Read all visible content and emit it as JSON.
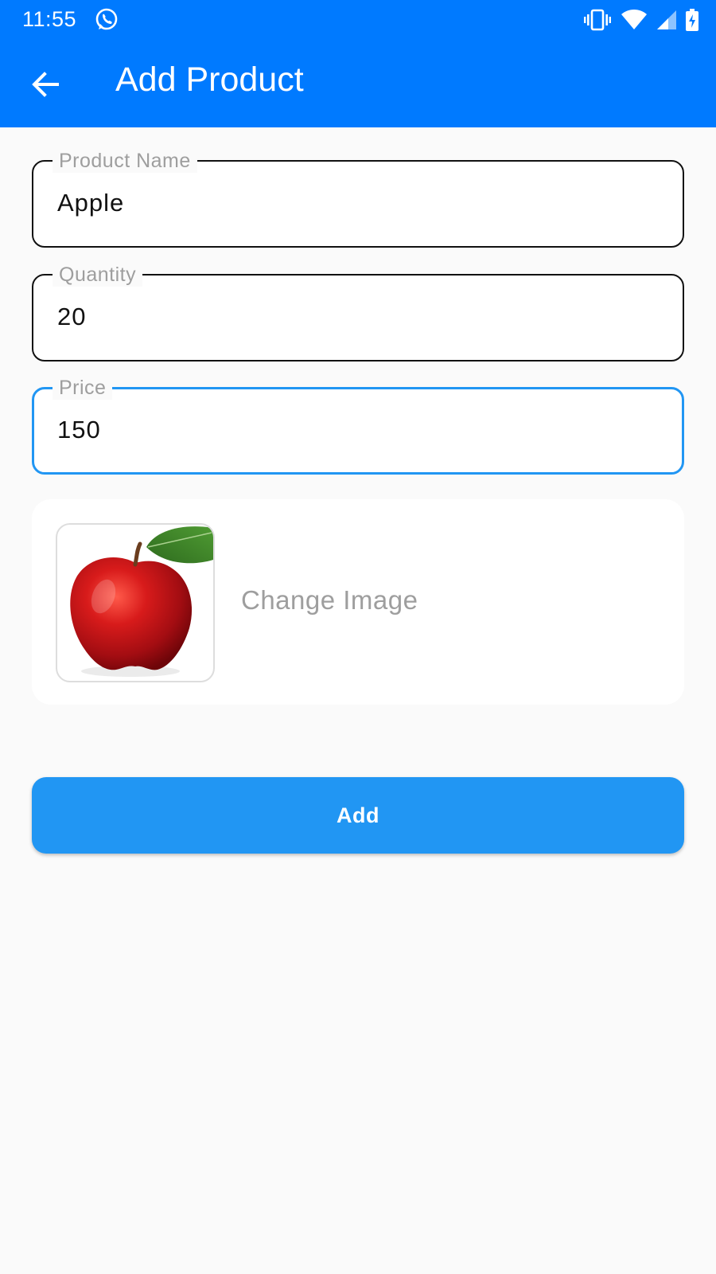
{
  "status_bar": {
    "time": "11:55",
    "icons": [
      "whatsapp-icon",
      "vibrate-icon",
      "wifi-icon",
      "cell-signal-icon",
      "battery-charging-icon"
    ]
  },
  "app_bar": {
    "title": "Add Product",
    "back_icon": "arrow-back-icon",
    "color": "#007aff"
  },
  "form": {
    "product_name": {
      "label": "Product Name",
      "value": "Apple"
    },
    "quantity": {
      "label": "Quantity",
      "value": "20"
    },
    "price": {
      "label": "Price",
      "value": "150",
      "focused": true
    }
  },
  "image_picker": {
    "thumbnail": "red-apple-image",
    "change_label": "Change Image"
  },
  "add_button": {
    "label": "Add",
    "color": "#2196f3"
  },
  "colors": {
    "focus": "#2196f3",
    "label": "#9e9e9e",
    "background": "#fafafa"
  }
}
